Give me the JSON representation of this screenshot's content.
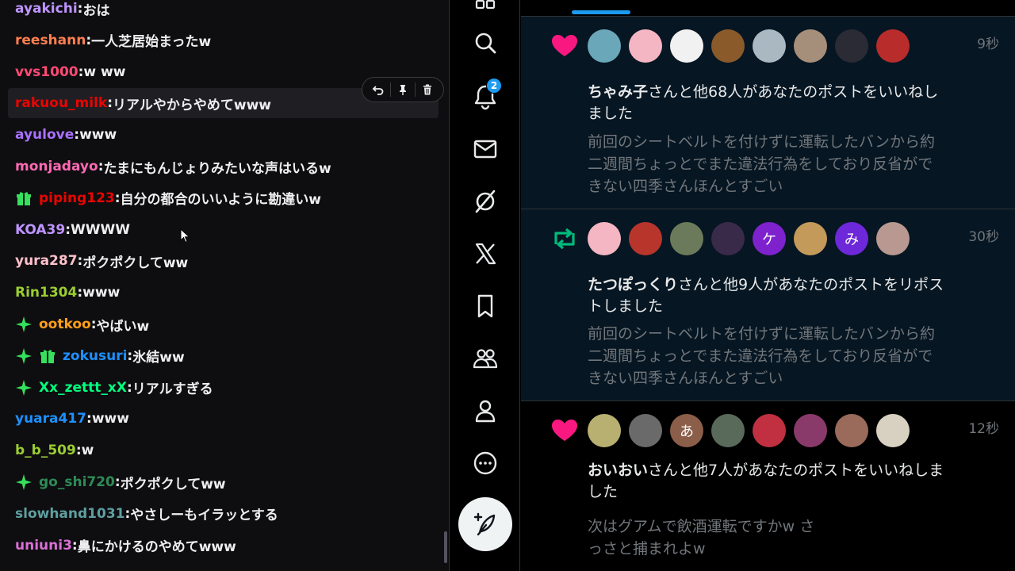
{
  "chat": {
    "messages": [
      {
        "user": "ayakichi",
        "color": "#bf94ff",
        "text": "おは",
        "badges": []
      },
      {
        "user": "reeshann",
        "color": "#ff7f50",
        "text": "一人芝居始まったw",
        "badges": []
      },
      {
        "user": "vvs1000",
        "color": "#ff4a75",
        "text": "w ww",
        "badges": []
      },
      {
        "user": "rakuou_milk",
        "color": "#eb0400",
        "text": "リアルやからやめてwww",
        "badges": []
      },
      {
        "user": "ayulove",
        "color": "#a970ff",
        "text": "www",
        "badges": []
      },
      {
        "user": "monjadayo",
        "color": "#ff69b4",
        "text": "たまにもんじょりみたいな声はいるw",
        "badges": []
      },
      {
        "user": "piping123",
        "color": "#eb0400",
        "text": "自分の都合のいいように勘違いw",
        "badges": [
          "gift-icon"
        ]
      },
      {
        "user": "KOA39",
        "color": "#bf94ff",
        "text": "WWWW",
        "badges": []
      },
      {
        "user": "yura287",
        "color": "#ffc0cb",
        "text": "ポクポクしてww",
        "badges": []
      },
      {
        "user": "Rin1304",
        "color": "#9acd32",
        "text": "www",
        "badges": []
      },
      {
        "user": "ootkoo",
        "color": "#ff9f1a",
        "text": "やばいw",
        "badges": [
          "sparkle-icon"
        ]
      },
      {
        "user": "zokusuri",
        "color": "#1e90ff",
        "text": "氷結ww",
        "badges": [
          "sparkle-icon",
          "gift-icon"
        ]
      },
      {
        "user": "Xx_zettt_xX",
        "color": "#00ff7f",
        "text": "リアルすぎる",
        "badges": [
          "sparkle-icon"
        ]
      },
      {
        "user": "yuara417",
        "color": "#1e90ff",
        "text": "www",
        "badges": []
      },
      {
        "user": "b_b_509",
        "color": "#9acd32",
        "text": "w",
        "badges": []
      },
      {
        "user": "go_shi720",
        "color": "#2e8b57",
        "text": "ポクポクしてww",
        "badges": [
          "sparkle-icon"
        ]
      },
      {
        "user": "slowhand1031",
        "color": "#5f9ea0",
        "text": "やさしーもイラッとする",
        "badges": []
      },
      {
        "user": "uniuni3",
        "color": "#da70d6",
        "text": "鼻にかけるのやめてwww",
        "badges": []
      }
    ],
    "actions": [
      "undo-icon",
      "pin-icon",
      "delete-icon"
    ]
  },
  "nav": {
    "items": [
      "grid-icon",
      "search-icon",
      "bell-icon",
      "mail-icon",
      "grok-icon",
      "x-logo-icon",
      "bookmark-icon",
      "communities-icon",
      "profile-icon",
      "more-icon"
    ],
    "notif_count": "2",
    "compose_icon": "compose-feather-icon"
  },
  "notifications": [
    {
      "type": "like",
      "icon": "heart-icon",
      "time": "9秒",
      "name": "ちゃみ子",
      "action": "さんと他68人があなたのポストをいいねしました",
      "quote": "前回のシートベルトを付けずに運転したバンから約二週間ちょっとでまた違法行為をしており反省ができない四季さんほんとすごい",
      "avatars": [
        {
          "bg": "#6aa7b8",
          "label": ""
        },
        {
          "bg": "#f4b6c2",
          "label": ""
        },
        {
          "bg": "#f1f1f1",
          "label": ""
        },
        {
          "bg": "#8a5a2b",
          "label": ""
        },
        {
          "bg": "#aab8c2",
          "label": ""
        },
        {
          "bg": "#a58e7a",
          "label": ""
        },
        {
          "bg": "#2b2b35",
          "label": ""
        },
        {
          "bg": "#b82c2c",
          "label": ""
        }
      ]
    },
    {
      "type": "repost",
      "icon": "repost-icon",
      "time": "30秒",
      "name": "たつぽっくり",
      "action": "さんと他9人があなたのポストをリポストしました",
      "quote": "前回のシートベルトを付けずに運転したバンから約二週間ちょっとでまた違法行為をしており反省ができない四季さんほんとすごい",
      "avatars": [
        {
          "bg": "#f4b6c2",
          "label": ""
        },
        {
          "bg": "#b8352c",
          "label": ""
        },
        {
          "bg": "#6b7a5a",
          "label": ""
        },
        {
          "bg": "#3a2a4a",
          "label": ""
        },
        {
          "bg": "#7e22ce",
          "label": "ケ"
        },
        {
          "bg": "#c49a5a",
          "label": ""
        },
        {
          "bg": "#6d28d9",
          "label": "み"
        },
        {
          "bg": "#b89890",
          "label": ""
        }
      ]
    },
    {
      "type": "like",
      "icon": "heart-icon",
      "time": "12秒",
      "name": "おいおい",
      "action": "さんと他7人があなたのポストをいいねしました",
      "quote": "次はグアムで飲酒運転ですかw さっさと捕まれよw",
      "avatars": [
        {
          "bg": "#b8b070",
          "label": ""
        },
        {
          "bg": "#6a6a6a",
          "label": ""
        },
        {
          "bg": "#8b5e4a",
          "label": "あ"
        },
        {
          "bg": "#5a6a5a",
          "label": ""
        },
        {
          "bg": "#c03040",
          "label": ""
        },
        {
          "bg": "#8a3a6a",
          "label": ""
        },
        {
          "bg": "#9a6a5a",
          "label": ""
        },
        {
          "bg": "#d8d0c0",
          "label": ""
        }
      ]
    }
  ]
}
